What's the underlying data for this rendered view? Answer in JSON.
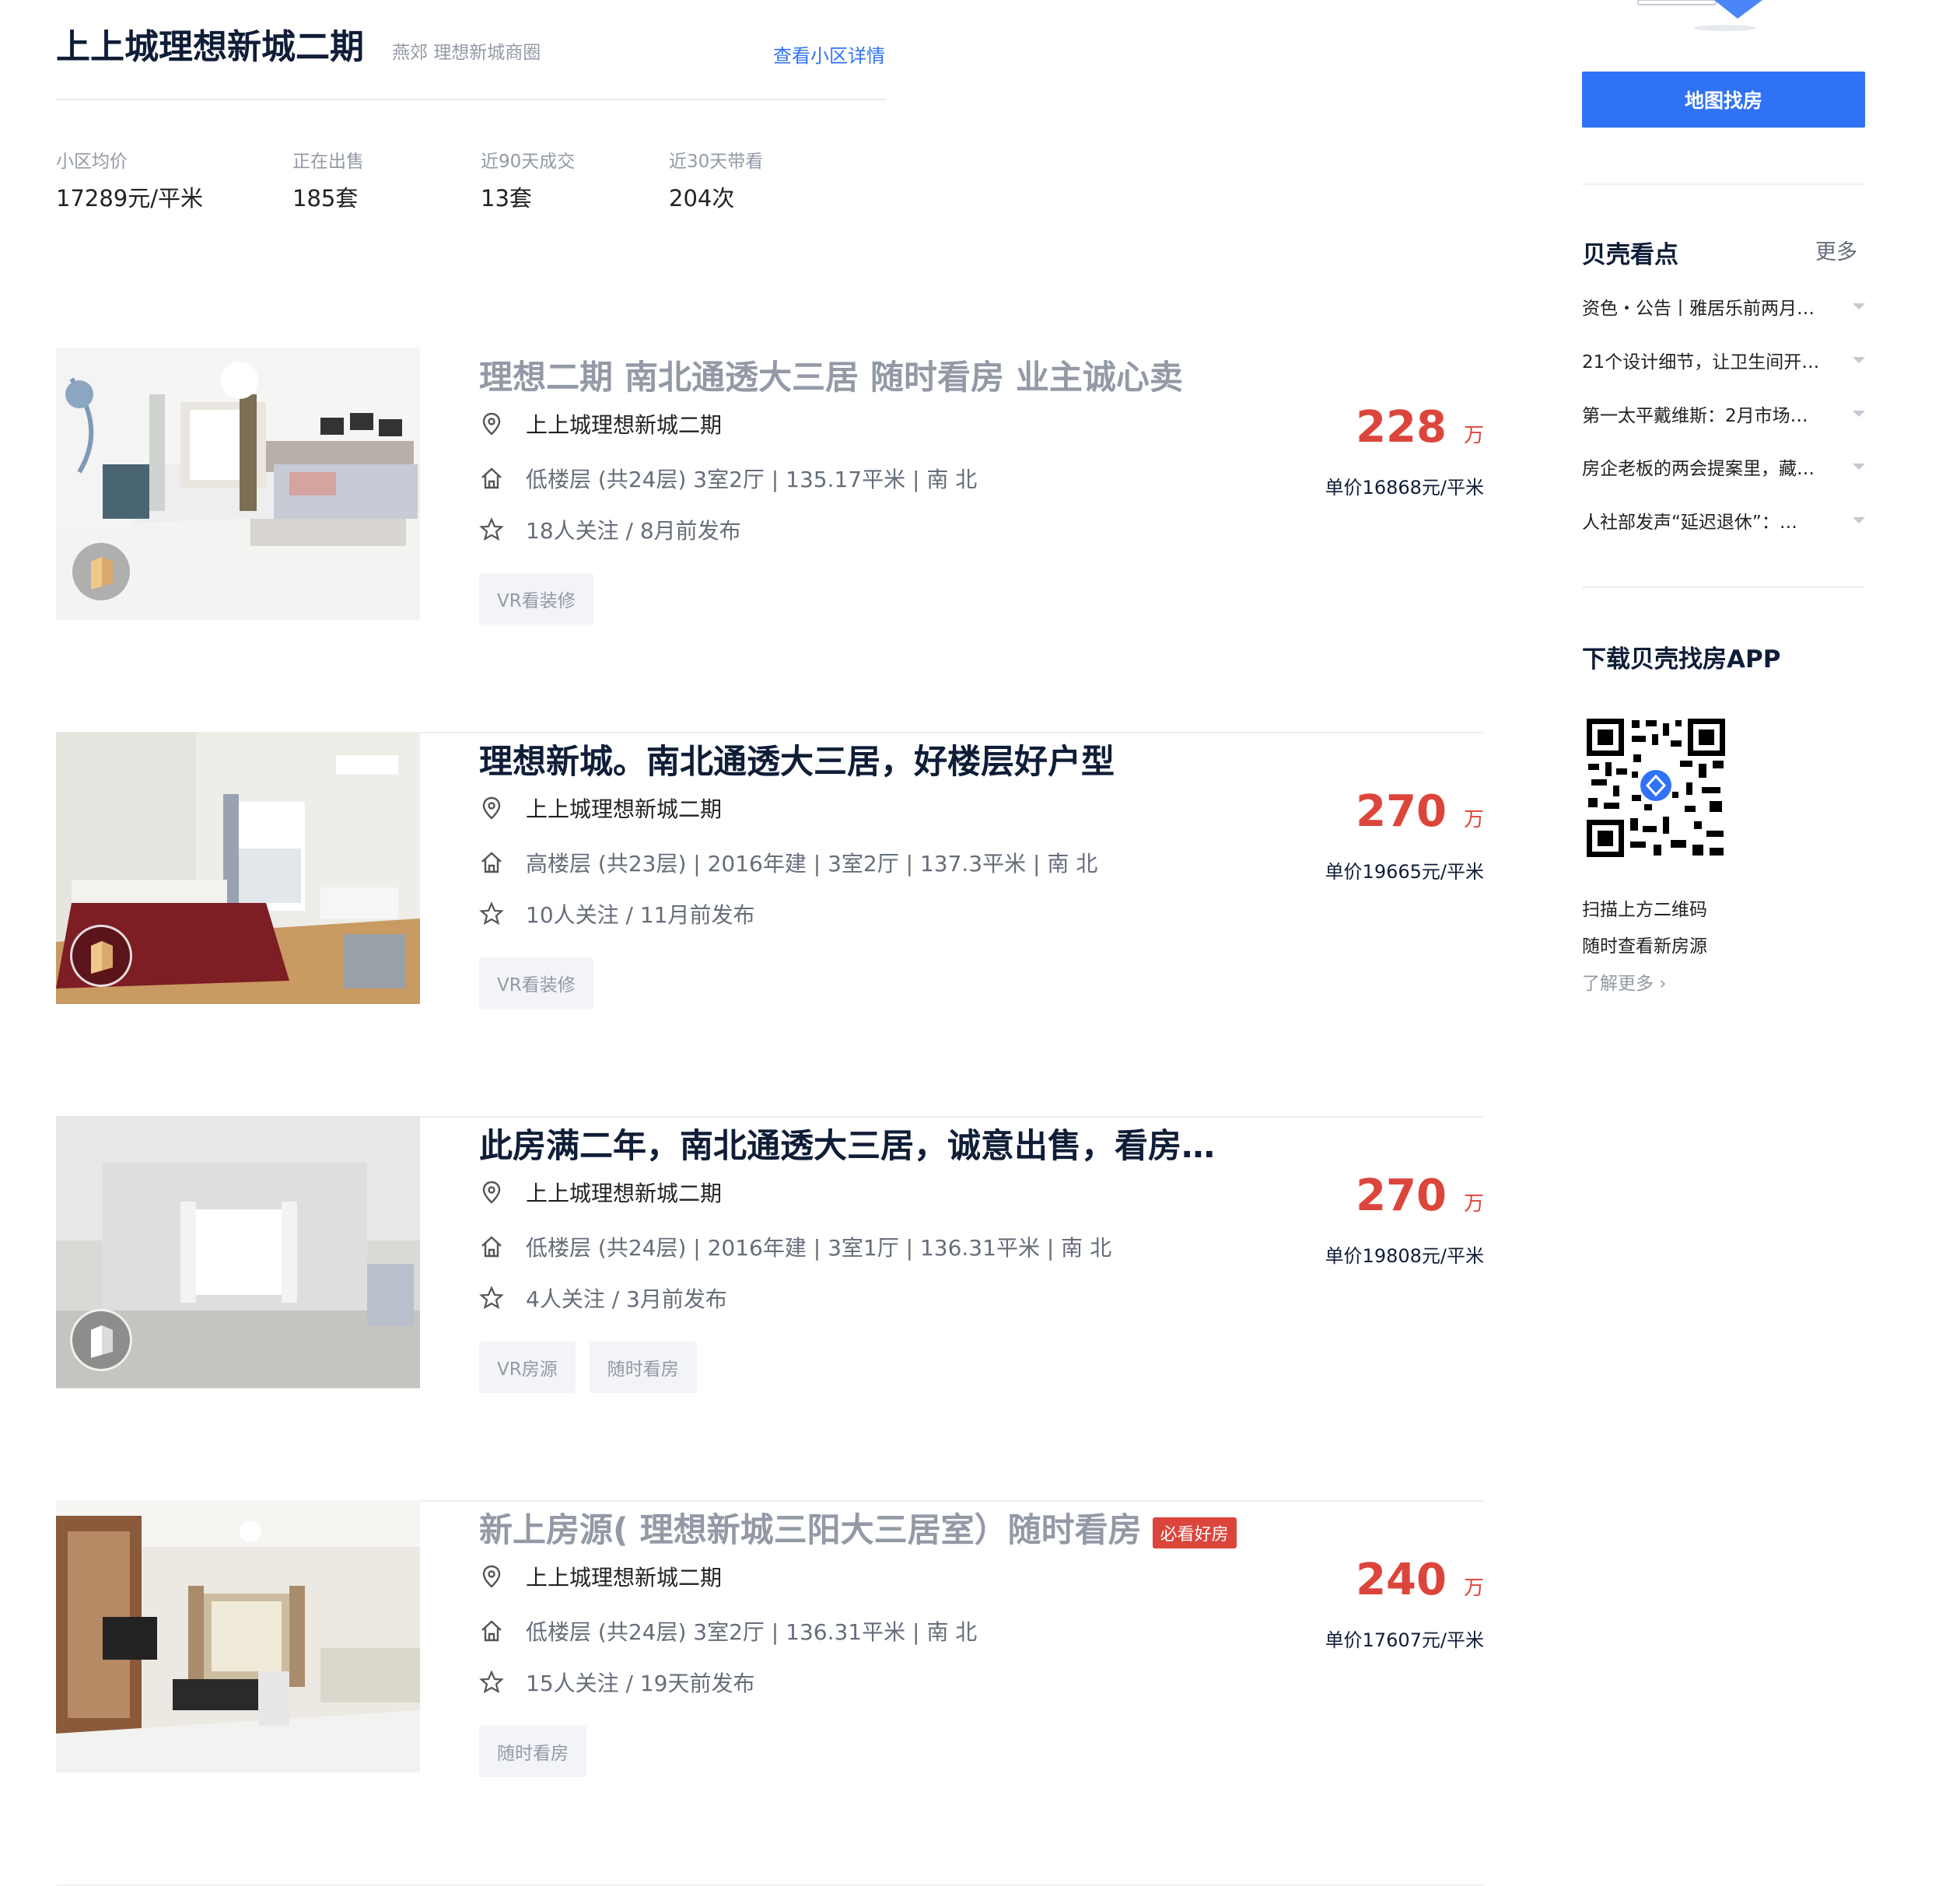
{
  "community": {
    "title": "上上城理想新城二期",
    "subtitle": "燕郊 理想新城商圈",
    "detail_link": "查看小区详情",
    "stats": [
      {
        "label": "小区均价",
        "value": "17289元/平米"
      },
      {
        "label": "正在出售",
        "value": "185套"
      },
      {
        "label": "近90天成交",
        "value": "13套"
      },
      {
        "label": "近30天带看",
        "value": "204次"
      }
    ]
  },
  "listings": [
    {
      "title": "理想二期 南北通透大三居 随时看房 业主诚心卖",
      "community": "上上城理想新城二期",
      "info": "低楼层 (共24层) 3室2厅 | 135.17平米 | 南 北",
      "follow": "18人关注 / 8月前发布",
      "tags": [
        "VR看装修"
      ],
      "price": "228",
      "price_unit": "万",
      "unit_price": "单价16868元/平米"
    },
    {
      "title": "理想新城。南北通透大三居，好楼层好户型",
      "community": "上上城理想新城二期",
      "info": "高楼层 (共23层) | 2016年建 | 3室2厅 | 137.3平米 | 南 北",
      "follow": "10人关注 / 11月前发布",
      "tags": [
        "VR看装修"
      ],
      "price": "270",
      "price_unit": "万",
      "unit_price": "单价19665元/平米"
    },
    {
      "title": "此房满二年，南北通透大三居，诚意出售，看房…",
      "community": "上上城理想新城二期",
      "info": "低楼层 (共24层) | 2016年建 | 3室1厅 | 136.31平米 | 南 北",
      "follow": "4人关注 / 3月前发布",
      "tags": [
        "VR房源",
        "随时看房"
      ],
      "price": "270",
      "price_unit": "万",
      "unit_price": "单价19808元/平米"
    },
    {
      "title": "新上房源( 理想新城三阳大三居室）随时看房",
      "badge": "必看好房",
      "community": "上上城理想新城二期",
      "info": "低楼层 (共24层) 3室2厅 | 136.31平米 | 南 北",
      "follow": "15人关注 / 19天前发布",
      "tags": [
        "随时看房"
      ],
      "price": "240",
      "price_unit": "万",
      "unit_price": "单价17607元/平米"
    }
  ],
  "sidebar": {
    "map_button": "地图找房",
    "news_title": "贝壳看点",
    "news_more": "更多",
    "news": [
      "资色・公告丨雅居乐前两月…",
      "21个设计细节，让卫生间开…",
      "第一太平戴维斯：2月市场…",
      "房企老板的两会提案里，藏…",
      "人社部发声“延迟退休”：…"
    ],
    "app_title": "下载贝壳找房APP",
    "app_line1": "扫描上方二维码",
    "app_line2": "随时查看新房源",
    "learn_more": "了解更多 ›"
  },
  "colors": {
    "accent": "#3072f6",
    "price": "#dc453c",
    "title": "#101d37",
    "muted": "#9399a5"
  }
}
